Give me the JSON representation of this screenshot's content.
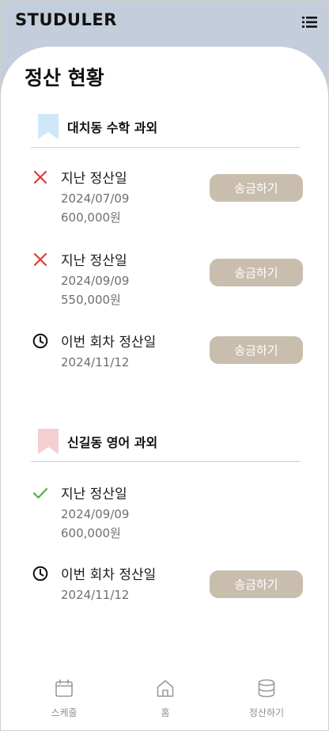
{
  "app": {
    "logo": "STUDULER"
  },
  "page": {
    "title": "정산 현황"
  },
  "sections": [
    {
      "title": "대치동 수학 과외",
      "bookmark_color": "#cfe8f7",
      "items": [
        {
          "status": "missed",
          "status_icon": "x-icon",
          "label": "지난 정산일",
          "date": "2024/07/09",
          "amount": "600,000원",
          "button": "송금하기"
        },
        {
          "status": "missed",
          "status_icon": "x-icon",
          "label": "지난 정산일",
          "date": "2024/09/09",
          "amount": "550,000원",
          "button": "송금하기"
        },
        {
          "status": "upcoming",
          "status_icon": "clock-icon",
          "label": "이번 회차 정산일",
          "date": "2024/11/12",
          "button": "송금하기"
        }
      ]
    },
    {
      "title": "신길동 영어 과외",
      "bookmark_color": "#f5cfcf",
      "items": [
        {
          "status": "paid",
          "status_icon": "check-icon",
          "label": "지난 정산일",
          "date": "2024/09/09",
          "amount": "600,000원"
        },
        {
          "status": "upcoming",
          "status_icon": "clock-icon",
          "label": "이번 회차 정산일",
          "date": "2024/11/12",
          "button": "송금하기"
        }
      ]
    }
  ],
  "nav": [
    {
      "label": "스케줄",
      "icon": "calendar-icon"
    },
    {
      "label": "홈",
      "icon": "home-icon"
    },
    {
      "label": "정산하기",
      "icon": "database-icon"
    }
  ],
  "colors": {
    "header_bg": "#c3cddb",
    "button_bg": "#c9beae",
    "missed": "#e03a3a",
    "paid": "#4cb050"
  }
}
